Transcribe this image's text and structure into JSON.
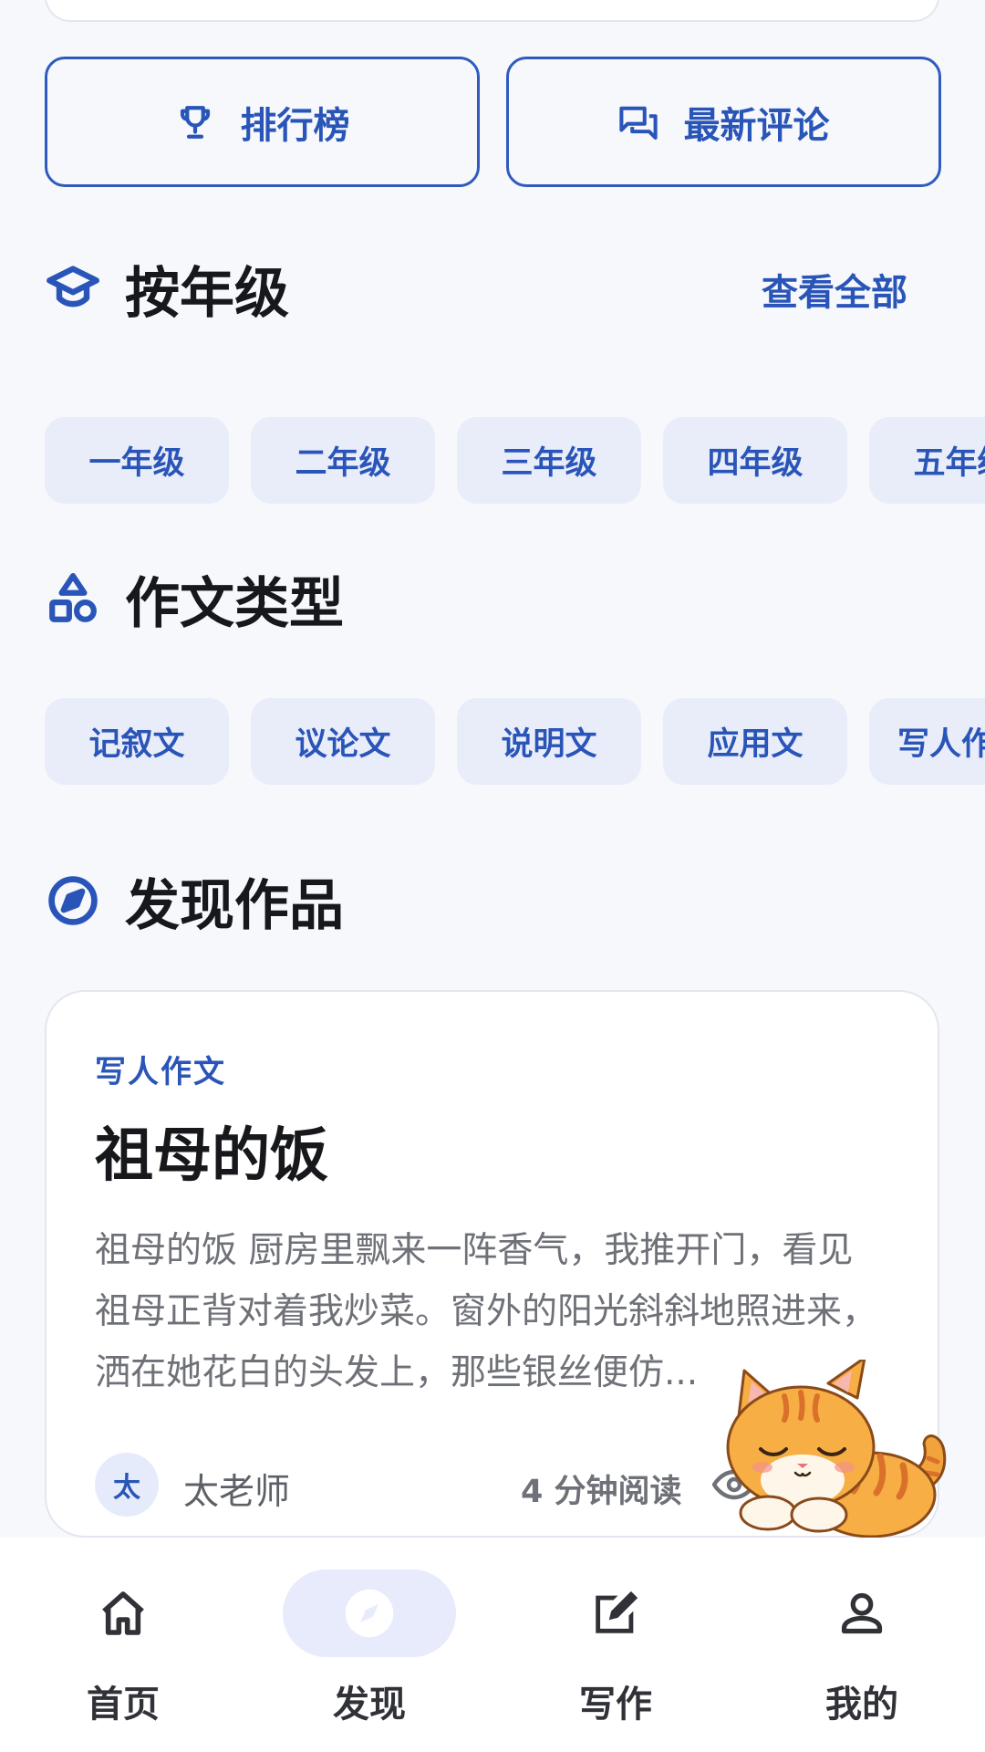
{
  "quick_actions": {
    "ranking": {
      "label": "排行榜",
      "icon": "trophy-icon"
    },
    "latest_comments": {
      "label": "最新评论",
      "icon": "comments-icon"
    }
  },
  "grades": {
    "title": "按年级",
    "icon": "graduation-cap-icon",
    "see_all": "查看全部",
    "items": [
      "一年级",
      "二年级",
      "三年级",
      "四年级",
      "五年级"
    ]
  },
  "essay_types": {
    "title": "作文类型",
    "icon": "shapes-icon",
    "items": [
      "记叙文",
      "议论文",
      "说明文",
      "应用文",
      "写人作文"
    ]
  },
  "discover": {
    "title": "发现作品",
    "icon": "compass-icon",
    "card": {
      "type": "写人作文",
      "title": "祖母的饭",
      "excerpt": "祖母的饭 厨房里飘来一阵香气，我推开门，看见祖母正背对着我炒菜。窗外的阳光斜斜地照进来，洒在她花白的头发上，那些银丝便仿...",
      "author_initial": "太",
      "author_name": "太老师",
      "read_time": "4 分钟阅读"
    }
  },
  "bottom_nav": {
    "active": "discover",
    "items": [
      {
        "id": "home",
        "label": "首页",
        "icon": "home-icon"
      },
      {
        "id": "discover",
        "label": "发现",
        "icon": "compass-icon"
      },
      {
        "id": "write",
        "label": "写作",
        "icon": "edit-icon"
      },
      {
        "id": "mine",
        "label": "我的",
        "icon": "person-icon"
      }
    ]
  },
  "colors": {
    "accent": "#2a55b8",
    "chip_bg": "#e9edfa",
    "background": "#f6f8fb",
    "card_bg": "#ffffff"
  }
}
